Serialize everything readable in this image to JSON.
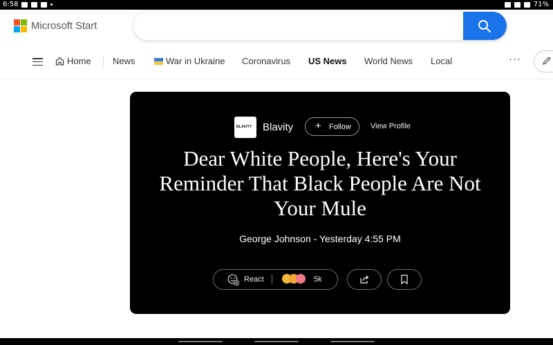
{
  "status_bar": {
    "time": "6:58",
    "battery": "71%"
  },
  "header": {
    "brand": "Microsoft Start",
    "brand_colors": [
      "#f25022",
      "#7fba00",
      "#00a4ef",
      "#ffb900"
    ],
    "search": {
      "value": "",
      "placeholder": ""
    },
    "accent": "#1a73e8"
  },
  "nav": {
    "items": [
      {
        "label": "Home",
        "icon": "home-icon"
      },
      {
        "label": "News"
      },
      {
        "label": "War in Ukraine",
        "icon": "ukraine-flag-icon"
      },
      {
        "label": "Coronavirus"
      },
      {
        "label": "US News",
        "active": true
      },
      {
        "label": "World News"
      },
      {
        "label": "Local"
      }
    ],
    "more": "···"
  },
  "article": {
    "publisher": {
      "name": "Blavity",
      "logo_text": "BLAVITY"
    },
    "follow_label": "Follow",
    "view_profile_label": "View Profile",
    "headline": "Dear White People, Here's Your Reminder That Black People Are Not Your Mule",
    "byline": "George Johnson - Yesterday 4:55 PM",
    "react_label": "React",
    "reaction_count": "5k"
  }
}
